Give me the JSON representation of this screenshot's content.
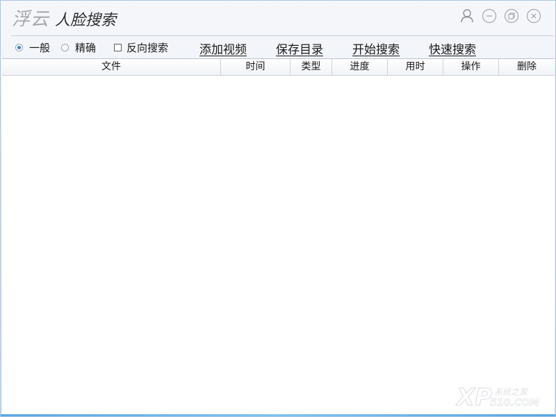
{
  "app": {
    "brand": "浮云",
    "product": "人脸搜索"
  },
  "title_controls": [
    {
      "name": "user-icon"
    },
    {
      "name": "minimize-icon"
    },
    {
      "name": "restore-icon"
    },
    {
      "name": "close-icon"
    }
  ],
  "toolbar": {
    "mode_general": "一般",
    "mode_precise": "精确",
    "mode_selected": "一般",
    "reverse_search": "反向搜索",
    "reverse_search_checked": false,
    "add_video": "添加视频",
    "save_dir": "保存目录",
    "start_search": "开始搜索",
    "quick_search": "快速搜索"
  },
  "table": {
    "columns": [
      "文件",
      "时间",
      "类型",
      "进度",
      "用时",
      "操作",
      "删除"
    ],
    "rows": []
  },
  "watermark": {
    "logo": "XP",
    "text_cn": "系统之家",
    "text_en": "510.COM"
  },
  "colors": {
    "accent": "#2f82d6",
    "border": "#a9c4df",
    "bottom_bar": "#5aa7e3"
  }
}
